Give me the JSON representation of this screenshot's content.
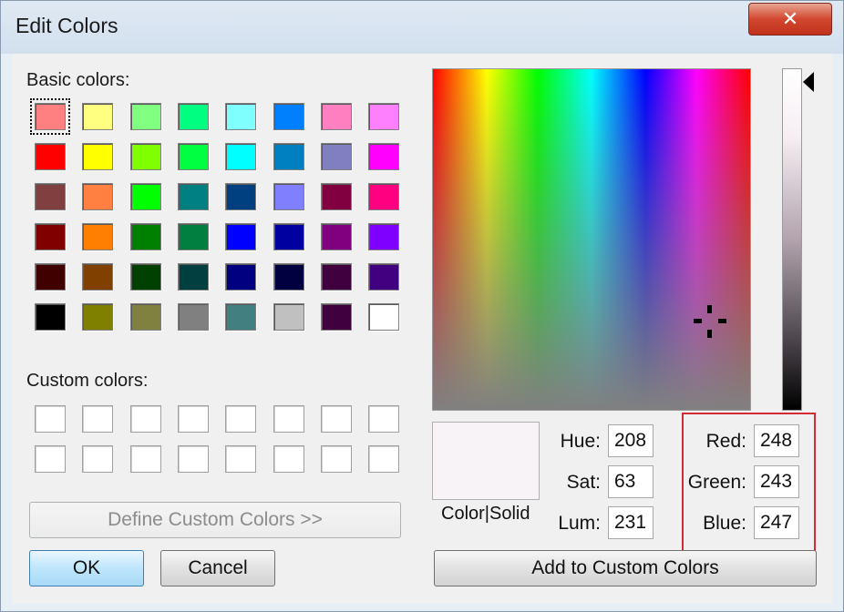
{
  "window": {
    "title": "Edit Colors",
    "close_label": "✕"
  },
  "basic_colors": {
    "label": "Basic colors:",
    "selected_index": 0,
    "swatches": [
      "#ff8080",
      "#ffff80",
      "#80ff80",
      "#00ff80",
      "#80ffff",
      "#0080ff",
      "#ff80c0",
      "#ff80ff",
      "#ff0000",
      "#ffff00",
      "#80ff00",
      "#00ff40",
      "#00ffff",
      "#0080c0",
      "#8080c0",
      "#ff00ff",
      "#804040",
      "#ff8040",
      "#00ff00",
      "#008080",
      "#004080",
      "#8080ff",
      "#800040",
      "#ff0080",
      "#800000",
      "#ff8000",
      "#008000",
      "#008040",
      "#0000ff",
      "#0000a0",
      "#800080",
      "#8000ff",
      "#400000",
      "#804000",
      "#004000",
      "#004040",
      "#000080",
      "#000040",
      "#400040",
      "#400080",
      "#000000",
      "#808000",
      "#808040",
      "#808080",
      "#408080",
      "#c0c0c0",
      "#400040",
      "#ffffff"
    ]
  },
  "custom_colors": {
    "label": "Custom colors:",
    "swatches": [
      "#ffffff",
      "#ffffff",
      "#ffffff",
      "#ffffff",
      "#ffffff",
      "#ffffff",
      "#ffffff",
      "#ffffff",
      "#ffffff",
      "#ffffff",
      "#ffffff",
      "#ffffff",
      "#ffffff",
      "#ffffff",
      "#ffffff",
      "#ffffff"
    ]
  },
  "buttons": {
    "define_custom": "Define Custom Colors >>",
    "ok": "OK",
    "cancel": "Cancel",
    "add_custom": "Add to Custom Colors"
  },
  "preview": {
    "label": "Color|Solid",
    "color": "#f8f3f7"
  },
  "hsl": {
    "hue_label": "Hue:",
    "hue": "208",
    "sat_label": "Sat:",
    "sat": "63",
    "lum_label": "Lum:",
    "lum": "231"
  },
  "rgb": {
    "red_label": "Red:",
    "red": "248",
    "green_label": "Green:",
    "green": "243",
    "blue_label": "Blue:",
    "blue": "247"
  },
  "accents": {
    "highlight_border": "#d42a33",
    "close_button": "#c0321b"
  }
}
